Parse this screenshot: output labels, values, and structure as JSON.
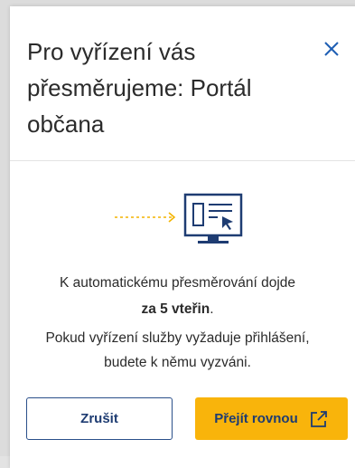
{
  "dialog": {
    "title": "Pro vyřízení vás přesměrujeme: Portál občana",
    "close_icon": "close-icon",
    "illustration_icon": "monitor-redirect-icon",
    "message_line1": "K automatickému přesměrování dojde",
    "message_countdown": "za 5 vteřin",
    "message_countdown_suffix": ".",
    "message_line3": "Pokud vyřízení služby vyžaduje přihlášení,",
    "message_line4": "budete k němu vyzváni.",
    "cancel_label": "Zrušit",
    "go_label": "Přejít rovnou",
    "go_icon": "external-link-icon"
  },
  "colors": {
    "accent": "#f9b40b",
    "brand_blue": "#1e3c72"
  }
}
